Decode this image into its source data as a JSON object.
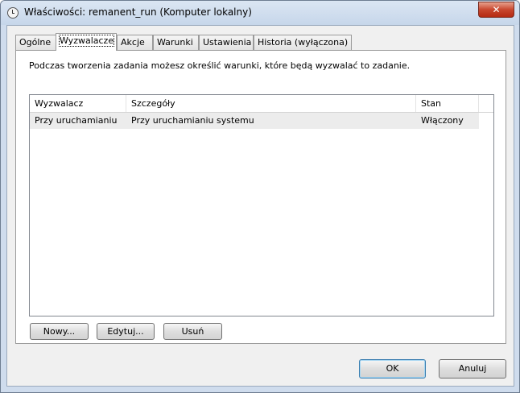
{
  "window": {
    "title": "Właściwości: remanent_run (Komputer lokalny)"
  },
  "tabs": [
    {
      "label": "Ogólne",
      "active": false
    },
    {
      "label": "Wyzwalacze",
      "active": true
    },
    {
      "label": "Akcje",
      "active": false
    },
    {
      "label": "Warunki",
      "active": false
    },
    {
      "label": "Ustawienia",
      "active": false
    },
    {
      "label": "Historia (wyłączona)",
      "active": false
    }
  ],
  "panel": {
    "description": "Podczas tworzenia zadania możesz określić warunki, które będą wyzwalać to zadanie.",
    "columns": [
      "Wyzwalacz",
      "Szczegóły",
      "Stan"
    ],
    "rows": [
      {
        "trigger": "Przy uruchamianiu",
        "details": "Przy uruchamianiu systemu",
        "state": "Włączony"
      }
    ],
    "buttons": {
      "new": "Nowy...",
      "edit": "Edytuj...",
      "delete": "Usuń"
    }
  },
  "footer": {
    "ok": "OK",
    "cancel": "Anuluj"
  },
  "icons": {
    "window": "clock-icon",
    "close": "close-icon"
  },
  "colors": {
    "close_button": "#c8472e",
    "title_bar": "#cfdced"
  }
}
